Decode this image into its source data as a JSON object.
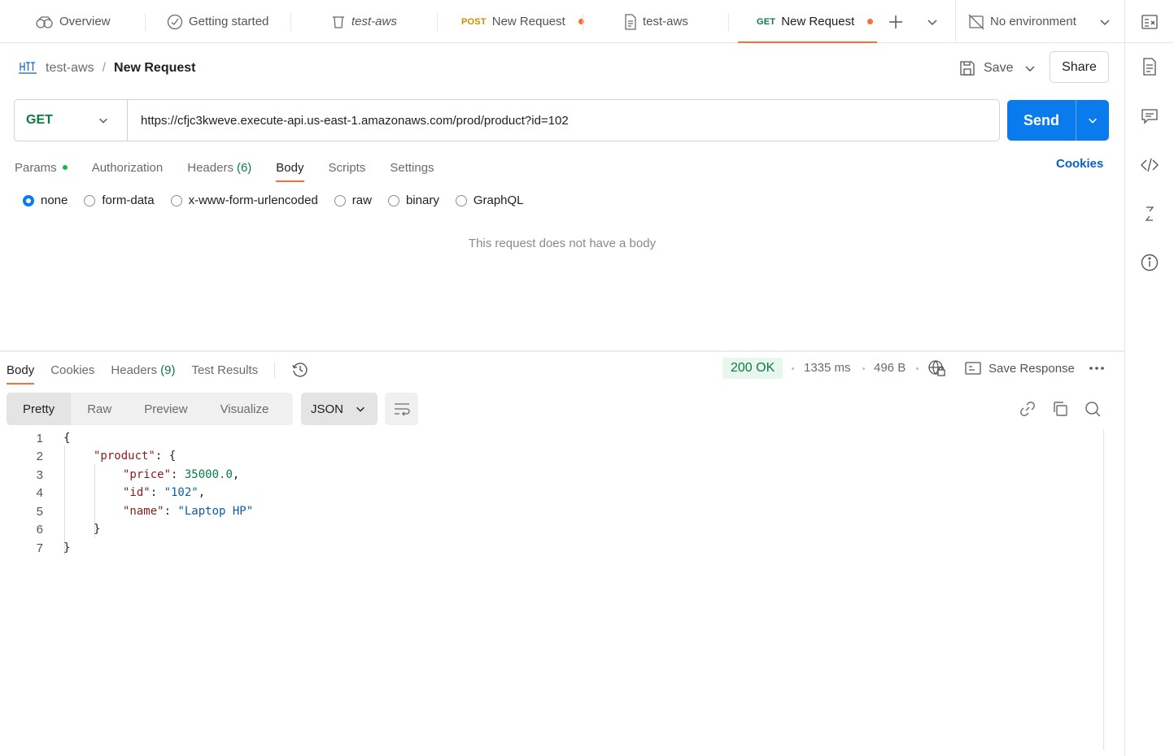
{
  "tabs": [
    {
      "label": "Overview",
      "icon": "overview-icon"
    },
    {
      "label": "Getting started",
      "icon": "getting-started-icon"
    },
    {
      "label": "test-aws",
      "icon": "trash-icon"
    },
    {
      "method": "POST",
      "label": "New Request",
      "unsaved": true
    },
    {
      "label": "test-aws",
      "icon": "document-icon"
    },
    {
      "method": "GET",
      "label": "New Request",
      "unsaved": true,
      "active": true
    }
  ],
  "environment": {
    "label": "No environment"
  },
  "breadcrumb": {
    "badge": "HTTP",
    "parent": "test-aws",
    "separator": "/",
    "title": "New Request"
  },
  "toolbar": {
    "save_label": "Save",
    "share_label": "Share"
  },
  "request": {
    "method": "GET",
    "url": "https://cfjc3kweve.execute-api.us-east-1.amazonaws.com/prod/product?id=102",
    "send_label": "Send"
  },
  "request_tabs": [
    {
      "label": "Params",
      "has_dot": true
    },
    {
      "label": "Authorization"
    },
    {
      "label": "Headers",
      "count": "(6)"
    },
    {
      "label": "Body",
      "active": true
    },
    {
      "label": "Scripts"
    },
    {
      "label": "Settings"
    }
  ],
  "cookies_link": "Cookies",
  "body_types": [
    {
      "label": "none",
      "checked": true
    },
    {
      "label": "form-data"
    },
    {
      "label": "x-www-form-urlencoded"
    },
    {
      "label": "raw"
    },
    {
      "label": "binary"
    },
    {
      "label": "GraphQL"
    }
  ],
  "no_body_text": "This request does not have a body",
  "response": {
    "tabs": [
      {
        "label": "Body",
        "active": true
      },
      {
        "label": "Cookies"
      },
      {
        "label": "Headers",
        "count": "(9)"
      },
      {
        "label": "Test Results"
      }
    ],
    "status": "200 OK",
    "time": "1335 ms",
    "size": "496 B",
    "save_response_label": "Save Response",
    "views": [
      "Pretty",
      "Raw",
      "Preview",
      "Visualize"
    ],
    "format": "JSON",
    "lines": [
      "1",
      "2",
      "3",
      "4",
      "5",
      "6",
      "7"
    ],
    "json": {
      "open": "{",
      "product_key": "\"product\"",
      "colon": ": ",
      "product_open": "{",
      "price_key": "\"price\"",
      "price_value": "35000.0",
      "id_key": "\"id\"",
      "id_value": "\"102\"",
      "name_key": "\"name\"",
      "name_value": "\"Laptop HP\"",
      "comma": ",",
      "product_close": "}",
      "close": "}"
    }
  },
  "colors": {
    "accent": "#ff6c37",
    "primary": "#097bed",
    "success": "#0b7a43"
  }
}
